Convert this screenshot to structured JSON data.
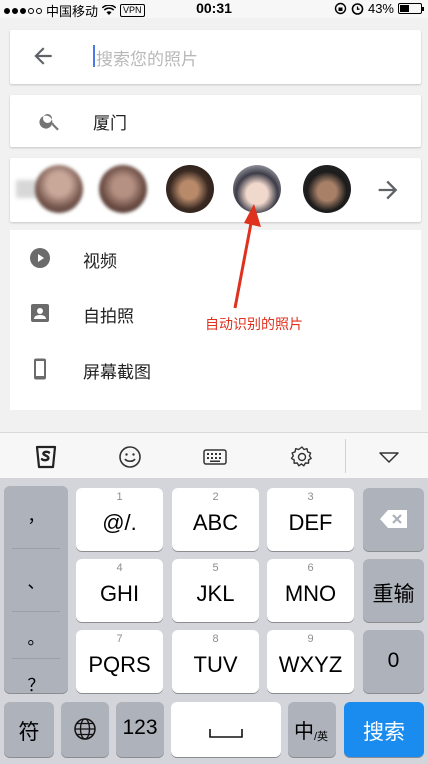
{
  "status_bar": {
    "carrier": "中国移动",
    "vpn": "VPN",
    "time": "00:31",
    "battery": "43%",
    "battery_level": 0.43
  },
  "search": {
    "placeholder": "搜索您的照片"
  },
  "query": {
    "text": "厦门"
  },
  "faces": {
    "count": 5
  },
  "menu": {
    "items": [
      {
        "label": "视频",
        "icon": "play-circle-icon"
      },
      {
        "label": "自拍照",
        "icon": "portrait-icon"
      },
      {
        "label": "屏幕截图",
        "icon": "phone-icon"
      }
    ]
  },
  "annotation": {
    "text": "自动识别的照片",
    "color": "#e0301e"
  },
  "keyboard": {
    "toolbar": [
      "sogou-logo-icon",
      "emoji-icon",
      "keyboard-icon",
      "settings-icon",
      "collapse-icon"
    ],
    "side_column": [
      "，",
      "、",
      "。",
      "？"
    ],
    "row1": [
      {
        "num": "1",
        "label": "@/."
      },
      {
        "num": "2",
        "label": "ABC"
      },
      {
        "num": "3",
        "label": "DEF"
      }
    ],
    "row2": [
      {
        "num": "4",
        "label": "GHI"
      },
      {
        "num": "5",
        "label": "JKL"
      },
      {
        "num": "6",
        "label": "MNO"
      }
    ],
    "row3": [
      {
        "num": "7",
        "label": "PQRS"
      },
      {
        "num": "8",
        "label": "TUV"
      },
      {
        "num": "9",
        "label": "WXYZ"
      }
    ],
    "reinput": "重输",
    "zero": "0",
    "symbol": "符",
    "num_key": "123",
    "lang_main": "中",
    "lang_sub": "/英",
    "search": "搜索",
    "accent_color": "#1a8cf0"
  }
}
